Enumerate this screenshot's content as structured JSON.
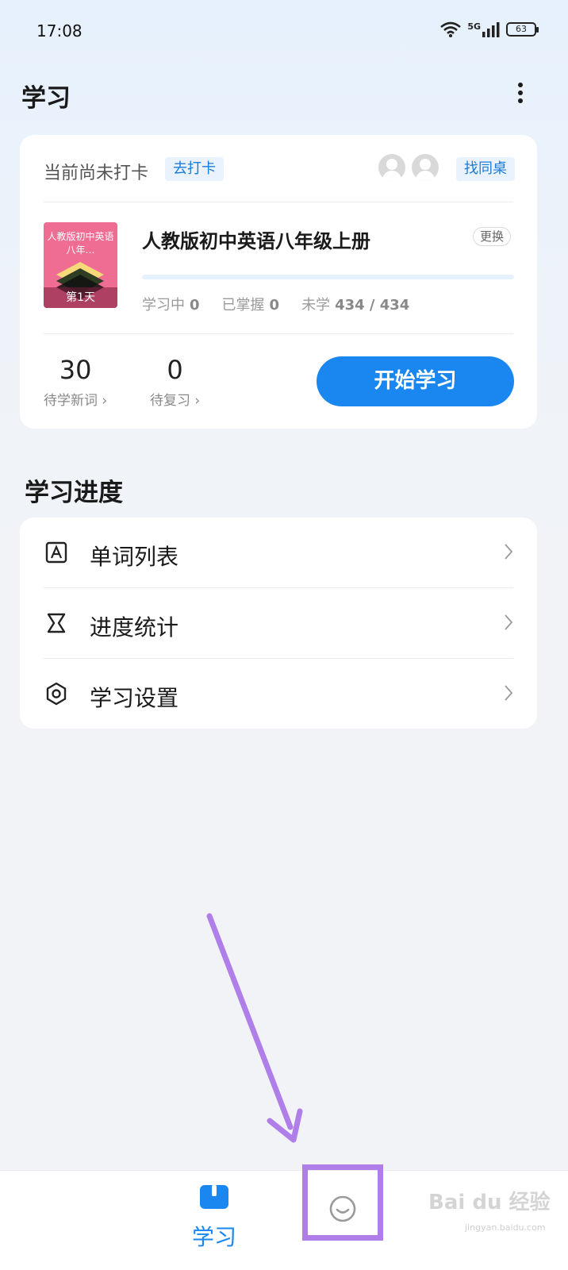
{
  "status_bar": {
    "time": "17:08",
    "network": "5G",
    "battery": "63"
  },
  "header": {
    "title": "学习"
  },
  "checkin": {
    "status_text": "当前尚未打卡",
    "checkin_label": "去打卡",
    "find_partner_label": "找同桌"
  },
  "book": {
    "cover_title": "人教版初中英语八年…",
    "day_label": "第1天",
    "title": "人教版初中英语八年级上册",
    "change_label": "更换",
    "progress_fraction": 0,
    "stats": [
      {
        "label": "学习中",
        "value": "0"
      },
      {
        "label": "已掌握",
        "value": "0"
      },
      {
        "label": "未学",
        "value": "434 / 434"
      }
    ]
  },
  "counts": {
    "new_words": {
      "value": "30",
      "label": "待学新词 ›"
    },
    "review": {
      "value": "0",
      "label": "待复习 ›"
    }
  },
  "start_button": "开始学习",
  "progress_section": {
    "title": "学习进度",
    "items": [
      {
        "label": "单词列表",
        "icon": "word-list-icon"
      },
      {
        "label": "进度统计",
        "icon": "hourglass-icon"
      },
      {
        "label": "学习设置",
        "icon": "settings-hexagon-icon"
      }
    ]
  },
  "bottom_nav": {
    "learn_label": "学习",
    "me_icon": "smile-icon"
  },
  "watermark": {
    "text": "Bai du 经验",
    "sub": "jingyan.baidu.com"
  },
  "colors": {
    "accent": "#1a86f0",
    "highlight": "#b07ee8",
    "book_cover": "#ef6d93"
  }
}
